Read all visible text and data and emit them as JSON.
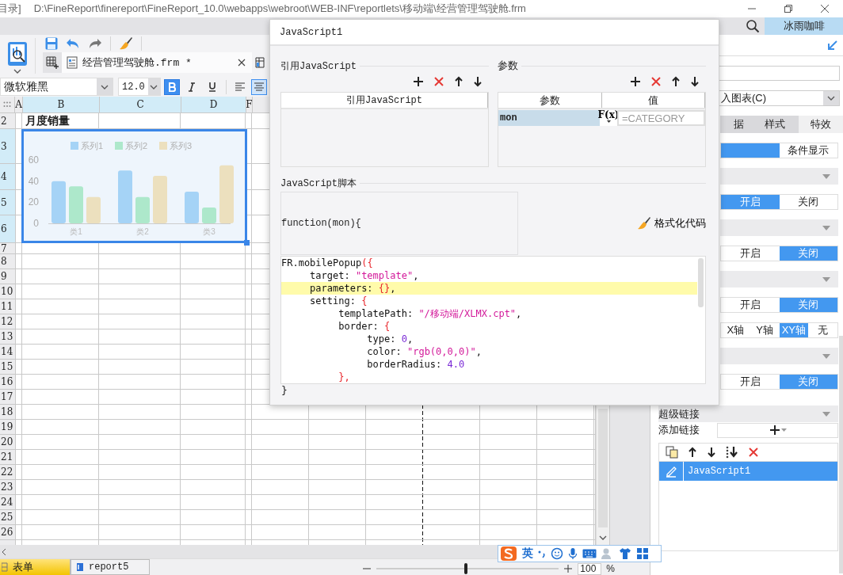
{
  "title_bar": {
    "prefix": "目录]",
    "path": "D:\\FineReport\\finereport\\FineReport_10.0\\webapps\\webroot\\WEB-INF\\reportlets\\移动端\\经营管理驾驶舱.frm"
  },
  "user": {
    "name": "冰雨咖啡"
  },
  "file_tabs": [
    {
      "label": "经营管理驾驶舱.frm *",
      "selected": true
    }
  ],
  "format_bar": {
    "font": "微软雅黑",
    "size": "12.0",
    "bold": true,
    "italic": false,
    "underline": false,
    "alignments": [
      {
        "kind": "left",
        "selected": false
      },
      {
        "kind": "center",
        "selected": true
      }
    ]
  },
  "sheet": {
    "columns": [
      {
        "label": "A",
        "highlighted": false
      },
      {
        "label": "B",
        "highlighted": true
      },
      {
        "label": "C",
        "highlighted": true
      },
      {
        "label": "D",
        "highlighted": true
      },
      {
        "label": "F",
        "highlighted": false
      }
    ],
    "rows": [
      {
        "label": "2",
        "highlighted": false
      },
      {
        "label": "3",
        "highlighted": true
      },
      {
        "label": "4",
        "highlighted": true
      },
      {
        "label": "5",
        "highlighted": true
      },
      {
        "label": "6",
        "highlighted": true
      },
      {
        "label": "7",
        "highlighted": false
      },
      {
        "label": "8",
        "highlighted": false
      },
      {
        "label": "9",
        "highlighted": false
      },
      {
        "label": "10",
        "highlighted": false
      },
      {
        "label": "11",
        "highlighted": false
      },
      {
        "label": "12",
        "highlighted": false
      },
      {
        "label": "13",
        "highlighted": false
      },
      {
        "label": "14",
        "highlighted": false
      },
      {
        "label": "15",
        "highlighted": false
      },
      {
        "label": "16",
        "highlighted": false
      },
      {
        "label": "17",
        "highlighted": false
      },
      {
        "label": "18",
        "highlighted": false
      },
      {
        "label": "19",
        "highlighted": false
      },
      {
        "label": "20",
        "highlighted": false
      },
      {
        "label": "21",
        "highlighted": false
      },
      {
        "label": "22",
        "highlighted": false
      },
      {
        "label": "23",
        "highlighted": false
      },
      {
        "label": "24",
        "highlighted": false
      },
      {
        "label": "25",
        "highlighted": false
      },
      {
        "label": "26",
        "highlighted": false
      }
    ],
    "title_cell": "月度销量"
  },
  "chart": {
    "selected": true,
    "chart_data": {
      "type": "bar",
      "legend": "top",
      "categories": [
        "类1",
        "类2",
        "类3"
      ],
      "series": [
        {
          "name": "系列1",
          "color": "#a5d3f6",
          "values": [
            40,
            50,
            30
          ]
        },
        {
          "name": "系列2",
          "color": "#ade8cb",
          "values": [
            35,
            25,
            15
          ]
        },
        {
          "name": "系列3",
          "color": "#ece0be",
          "values": [
            25,
            45,
            55
          ]
        }
      ],
      "ylim": [
        0,
        60
      ],
      "yticks": [
        0,
        20,
        40,
        60
      ]
    }
  },
  "dialog": {
    "title": "JavaScript1",
    "ref_js": {
      "title": "引用JavaScript",
      "column": "引用JavaScript"
    },
    "params": {
      "title": "参数",
      "columns": [
        "参数",
        "值"
      ],
      "formula_button": "F(x)",
      "rows": [
        {
          "name": "mon",
          "value": "=CATEGORY",
          "selected": true
        }
      ]
    },
    "script": {
      "title": "JavaScript脚本",
      "signature": "function(mon){",
      "format_button": "格式化代码",
      "closing": "}",
      "lines": [
        {
          "highlighted": false,
          "tokens": [
            {
              "text": "FR.mobilePopup",
              "kind": "plain"
            },
            {
              "text": "({",
              "kind": "brace"
            }
          ]
        },
        {
          "highlighted": false,
          "tokens": [
            {
              "text": "     target: ",
              "kind": "plain"
            },
            {
              "text": "\"template\"",
              "kind": "string"
            },
            {
              "text": ",",
              "kind": "plain"
            }
          ]
        },
        {
          "highlighted": true,
          "tokens": [
            {
              "text": "     parameters: ",
              "kind": "plain"
            },
            {
              "text": "{}",
              "kind": "brace"
            },
            {
              "text": ",",
              "kind": "plain"
            }
          ]
        },
        {
          "highlighted": false,
          "tokens": [
            {
              "text": "     setting: ",
              "kind": "plain"
            },
            {
              "text": "{",
              "kind": "brace"
            }
          ]
        },
        {
          "highlighted": false,
          "tokens": [
            {
              "text": "          templatePath: ",
              "kind": "plain"
            },
            {
              "text": "\"/移动端/XLMX.cpt\"",
              "kind": "string"
            },
            {
              "text": ",",
              "kind": "plain"
            }
          ]
        },
        {
          "highlighted": false,
          "tokens": [
            {
              "text": "          border: ",
              "kind": "plain"
            },
            {
              "text": "{",
              "kind": "brace"
            }
          ]
        },
        {
          "highlighted": false,
          "tokens": [
            {
              "text": "               type: ",
              "kind": "plain"
            },
            {
              "text": "0",
              "kind": "number"
            },
            {
              "text": ",",
              "kind": "plain"
            }
          ]
        },
        {
          "highlighted": false,
          "tokens": [
            {
              "text": "               color: ",
              "kind": "plain"
            },
            {
              "text": "\"rgb(0,0,0)\"",
              "kind": "string"
            },
            {
              "text": ",",
              "kind": "plain"
            }
          ]
        },
        {
          "highlighted": false,
          "tokens": [
            {
              "text": "               borderRadius: ",
              "kind": "plain"
            },
            {
              "text": "4.0",
              "kind": "number"
            }
          ]
        },
        {
          "highlighted": false,
          "tokens": [
            {
              "text": "          },",
              "kind": "brace"
            }
          ]
        }
      ]
    }
  },
  "right_panel": {
    "select": "入图表(C)",
    "tabs": [
      {
        "label": "据",
        "selected": false
      },
      {
        "label": "样式",
        "selected": false
      },
      {
        "label": "特效",
        "selected": true
      }
    ],
    "rows": [
      {
        "kind": "segment",
        "options": [
          {
            "selected": true
          },
          {
            "label": "条件显示",
            "selected": false
          }
        ]
      },
      {
        "kind": "section"
      },
      {
        "kind": "segment",
        "options": [
          {
            "label": "开启",
            "selected": true
          },
          {
            "label": "关闭",
            "selected": false
          }
        ]
      },
      {
        "kind": "section"
      },
      {
        "kind": "segment",
        "options": [
          {
            "label": "开启",
            "selected": false
          },
          {
            "label": "关闭",
            "selected": true
          }
        ]
      },
      {
        "kind": "section"
      },
      {
        "kind": "segment",
        "options": [
          {
            "label": "开启",
            "selected": false
          },
          {
            "label": "关闭",
            "selected": true
          }
        ]
      },
      {
        "kind": "segment",
        "options": [
          {
            "label": "X轴",
            "selected": false
          },
          {
            "label": "Y轴",
            "selected": false
          },
          {
            "label": "XY轴",
            "selected": true
          },
          {
            "label": "无",
            "selected": false
          }
        ]
      },
      {
        "kind": "section"
      },
      {
        "kind": "segment",
        "options": [
          {
            "label": "开启",
            "selected": false
          },
          {
            "label": "关闭",
            "selected": true
          }
        ]
      },
      {
        "kind": "section",
        "label": "超级链接"
      }
    ],
    "add_link": "添加链接",
    "links": [
      {
        "label": "JavaScript1",
        "selected": true
      }
    ]
  },
  "sheet_tabs": [
    {
      "label": "表单",
      "selected": true
    },
    {
      "label": "report5",
      "selected": false
    }
  ],
  "zoom": {
    "level": 0.49,
    "value": "100",
    "unit": "%"
  },
  "ime": {
    "mode": "英"
  }
}
